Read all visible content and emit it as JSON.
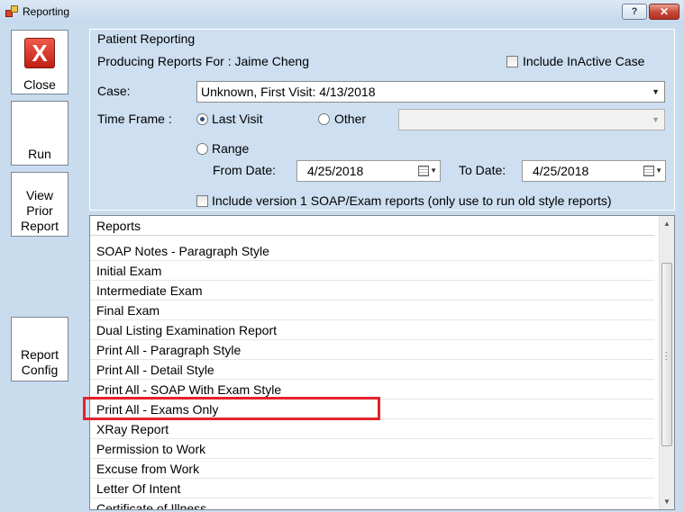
{
  "window": {
    "title": "Reporting",
    "help_label": "?",
    "close_label": "✕"
  },
  "sidebar": {
    "close_icon_glyph": "X",
    "close_label": "Close",
    "run_label": "Run",
    "view_prior_line1": "View",
    "view_prior_line2": "Prior",
    "view_prior_line3": "Report",
    "report_config_line1": "Report",
    "report_config_line2": "Config"
  },
  "patient_reporting": {
    "group_label": "Patient Reporting",
    "producing_text": "Producing Reports For : Jaime Cheng",
    "include_inactive_label": "Include  InActive Case",
    "include_inactive_checked": false,
    "case_label": "Case:",
    "case_value": "Unknown,  First Visit: 4/13/2018",
    "time_frame_label": "Time Frame :",
    "last_visit_label": "Last Visit",
    "last_visit_selected": true,
    "other_label": "Other",
    "other_value": "",
    "range_label": "Range",
    "from_date_label": "From Date:",
    "from_date_value": "4/25/2018",
    "to_date_label": "To Date:",
    "to_date_value": "4/25/2018",
    "include_v1_label": "Include version 1 SOAP/Exam reports (only use to run old style reports)",
    "include_v1_checked": false
  },
  "reports": {
    "header": "Reports",
    "items": [
      "SOAP Notes - Paragraph Style",
      "Initial Exam",
      "Intermediate Exam",
      "Final Exam",
      "Dual Listing Examination Report",
      "Print All - Paragraph Style",
      "Print All - Detail Style",
      "Print All - SOAP With Exam Style",
      "Print All - Exams Only",
      "XRay Report",
      "Permission to Work",
      "Excuse from Work",
      "Letter Of Intent",
      "Certificate of Illness"
    ],
    "highlighted_item": "Print All - Exams Only",
    "highlight_color": "#e3232c"
  }
}
